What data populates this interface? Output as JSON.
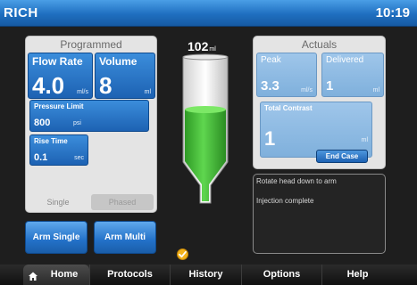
{
  "header": {
    "title": "RICH",
    "time": "10:19"
  },
  "programmed": {
    "title": "Programmed",
    "flow_rate": {
      "label": "Flow Rate",
      "value": "4.0",
      "unit": "ml/s"
    },
    "volume": {
      "label": "Volume",
      "value": "8",
      "unit": "ml"
    },
    "pressure_limit": {
      "label": "Pressure Limit",
      "value": "800",
      "unit": "psi"
    },
    "rise_time": {
      "label": "Rise Time",
      "value": "0.1",
      "unit": "sec"
    },
    "modes": [
      {
        "label": "Single",
        "selected": true
      },
      {
        "label": "Phased",
        "selected": false
      }
    ]
  },
  "syringe": {
    "volume_value": "102",
    "volume_unit": "ml",
    "fill_color": "#3fbf34"
  },
  "actuals": {
    "title": "Actuals",
    "peak": {
      "label": "Peak",
      "value": "3.3",
      "unit": "ml/s"
    },
    "delivered": {
      "label": "Delivered",
      "value": "1",
      "unit": "ml"
    },
    "total_contrast": {
      "label": "Total Contrast",
      "value": "1",
      "unit": "ml"
    },
    "end_case_label": "End Case"
  },
  "messages": [
    "Rotate head down to arm",
    "Injection complete"
  ],
  "arm_buttons": {
    "single": "Arm Single",
    "multi": "Arm Multi"
  },
  "nav": [
    {
      "label": "Home",
      "icon": "home-icon",
      "active": true
    },
    {
      "label": "Protocols",
      "active": false
    },
    {
      "label": "History",
      "active": false
    },
    {
      "label": "Options",
      "active": false
    },
    {
      "label": "Help",
      "active": false
    }
  ],
  "colors": {
    "accent": "#1f6fc0",
    "status": "#f2b21b"
  }
}
